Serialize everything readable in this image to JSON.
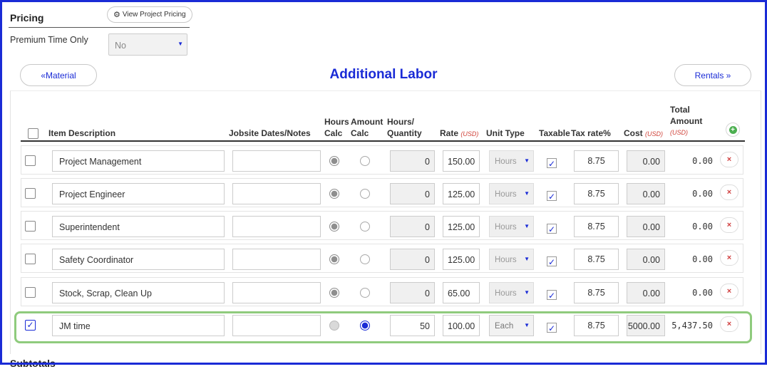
{
  "pricing": {
    "title": "Pricing",
    "view_project_pricing": "View Project Pricing",
    "premium_time_label": "Premium Time Only",
    "premium_time_value": "No"
  },
  "nav": {
    "prev_label": "Material",
    "next_label": "Rentals",
    "section_title": "Additional Labor"
  },
  "headers": {
    "item_description": "Item Description",
    "jobsite": "Jobsite Dates/Notes",
    "hours_calc_1": "Hours",
    "hours_calc_2": "Calc",
    "amount_calc_1": "Amount",
    "amount_calc_2": "Calc",
    "hours_qty_1": "Hours/",
    "hours_qty_2": "Quantity",
    "rate": "Rate",
    "rate_unit": "(USD)",
    "unit_type": "Unit Type",
    "taxable": "Taxable",
    "tax_rate": "Tax rate%",
    "cost": "Cost",
    "cost_unit": "(USD)",
    "total_1": "Total",
    "total_2": "Amount",
    "total_unit": "(USD)"
  },
  "rows": [
    {
      "desc": "Project Management",
      "notes": "",
      "qty": "0",
      "rate": "150.00",
      "unit": "Hours",
      "tax": "8.75",
      "cost": "0.00",
      "total": "0.00",
      "selected": false
    },
    {
      "desc": "Project Engineer",
      "notes": "",
      "qty": "0",
      "rate": "125.00",
      "unit": "Hours",
      "tax": "8.75",
      "cost": "0.00",
      "total": "0.00",
      "selected": false
    },
    {
      "desc": "Superintendent",
      "notes": "",
      "qty": "0",
      "rate": "125.00",
      "unit": "Hours",
      "tax": "8.75",
      "cost": "0.00",
      "total": "0.00",
      "selected": false
    },
    {
      "desc": "Safety Coordinator",
      "notes": "",
      "qty": "0",
      "rate": "125.00",
      "unit": "Hours",
      "tax": "8.75",
      "cost": "0.00",
      "total": "0.00",
      "selected": false
    },
    {
      "desc": "Stock, Scrap, Clean Up",
      "notes": "",
      "qty": "0",
      "rate": "65.00",
      "unit": "Hours",
      "tax": "8.75",
      "cost": "0.00",
      "total": "0.00",
      "selected": false
    },
    {
      "desc": "JM time",
      "notes": "",
      "qty": "50",
      "rate": "100.00",
      "unit": "Each",
      "tax": "8.75",
      "cost": "5000.00",
      "total": "5,437.50",
      "selected": true
    }
  ],
  "footer": {
    "subtotals": "Subtotals"
  },
  "colors": {
    "accent": "#1a2bd6",
    "highlight_border": "#8fcb7d",
    "delete": "#d04040",
    "add": "#4caf50"
  }
}
